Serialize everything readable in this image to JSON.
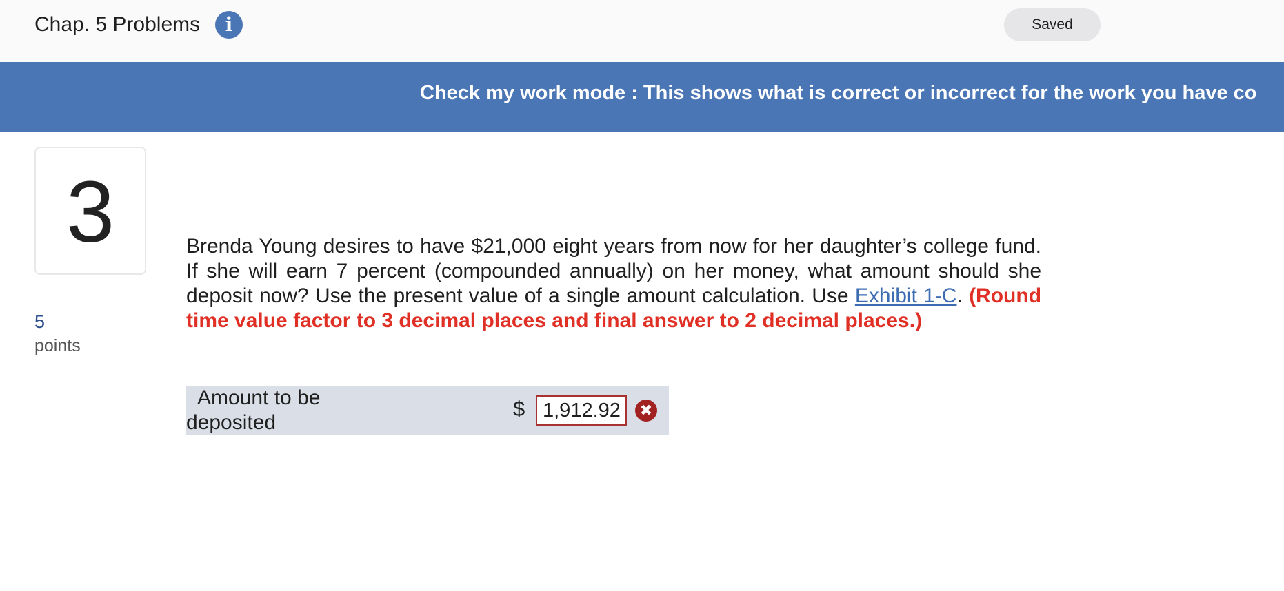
{
  "header": {
    "title": "Chap. 5 Problems",
    "info_icon": "info-icon",
    "saved_label": "Saved"
  },
  "banner": {
    "text": "Check my work mode : This shows what is correct or incorrect for the work you have co"
  },
  "question": {
    "number": "3",
    "points_value": "5",
    "points_label": "points",
    "text_before_link": "Brenda Young desires to have $21,000 eight years from now for her daughter’s college fund. If she will earn 7 percent (compounded annually) on her money, what amount should she deposit now? Use the present value of a single amount calculation. Use ",
    "link_text": "Exhibit 1-C",
    "text_after_link": ". ",
    "instruction": "(Round time value factor to 3 decimal places and final answer to 2 decimal places.)"
  },
  "answer": {
    "label": "Amount to be deposited",
    "currency": "$",
    "value": "1,912.92",
    "status_icon": "incorrect-icon",
    "status_symbol": "✖"
  },
  "colors": {
    "banner": "#4a76b6",
    "instruction": "#e03025",
    "incorrect": "#a22222",
    "answer_row": "#d9dee7"
  }
}
